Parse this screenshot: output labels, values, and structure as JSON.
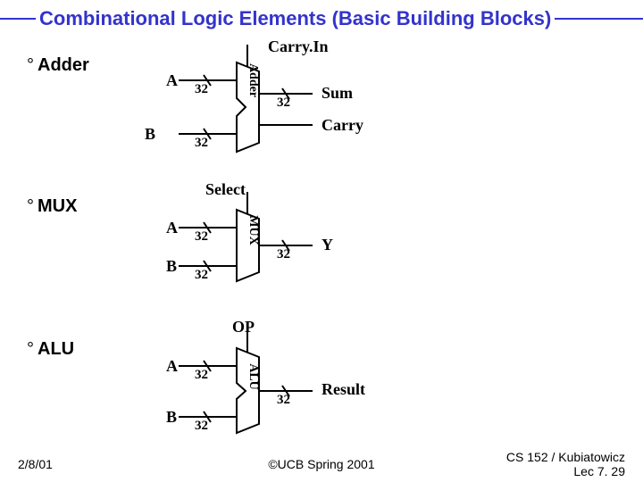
{
  "title": "Combinational Logic Elements (Basic Building Blocks)",
  "adder": {
    "heading": "Adder",
    "topInput": "Carry.In",
    "inputA": "A",
    "inputB": "B",
    "busA": "32",
    "busB": "32",
    "busOut": "32",
    "outputTop": "Sum",
    "outputBot": "Carry",
    "blockLabel": "Adder"
  },
  "mux": {
    "heading": "MUX",
    "topInput": "Select",
    "inputA": "A",
    "inputB": "B",
    "busA": "32",
    "busB": "32",
    "busOut": "32",
    "output": "Y",
    "blockLabel": "MUX"
  },
  "alu": {
    "heading": "ALU",
    "topInput": "OP",
    "inputA": "A",
    "inputB": "B",
    "busA": "32",
    "busB": "32",
    "busOut": "32",
    "output": "Result",
    "blockLabel": "ALU"
  },
  "footer": {
    "left": "2/8/01",
    "center": "©UCB Spring 2001",
    "right1": "CS 152 / Kubiatowicz",
    "right2": "Lec 7. 29"
  }
}
